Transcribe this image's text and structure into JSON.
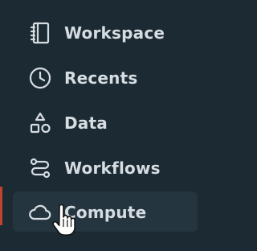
{
  "sidebar": {
    "items": [
      {
        "label": "Workspace",
        "icon": "notebook-icon",
        "active": false
      },
      {
        "label": "Recents",
        "icon": "clock-icon",
        "active": false
      },
      {
        "label": "Data",
        "icon": "shapes-icon",
        "active": false
      },
      {
        "label": "Workflows",
        "icon": "workflow-icon",
        "active": false
      },
      {
        "label": "Compute",
        "icon": "cloud-icon",
        "active": true
      }
    ]
  },
  "colors": {
    "background": "#1b2a33",
    "active_item_bg": "#243540",
    "text": "#d6dde2",
    "accent": "#c0432d"
  },
  "cursor": {
    "type": "pointer-hand"
  }
}
